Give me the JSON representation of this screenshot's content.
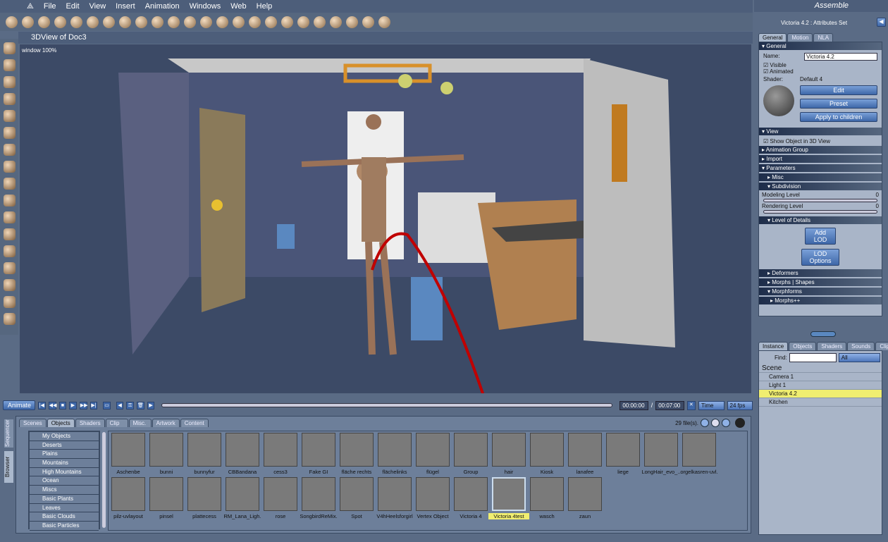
{
  "menu": [
    "File",
    "Edit",
    "View",
    "Insert",
    "Animation",
    "Windows",
    "Web",
    "Help"
  ],
  "room": "Assemble",
  "view": {
    "title": "3DView of Doc3",
    "zoom_label": "window 100%"
  },
  "timeline": {
    "animate": "Animate",
    "current": "00:00:00",
    "end": "00:07:00",
    "separator": "/",
    "mode": "Time",
    "fps": "24 fps"
  },
  "browser": {
    "side_tabs": [
      "Sequencer",
      "Browser"
    ],
    "tabs": [
      "Scenes",
      "Objects",
      "Shaders",
      "Clip",
      "Misc.",
      "Artwork",
      "Content"
    ],
    "active_tab": "Objects",
    "file_count": "29 file(s).",
    "categories": [
      "My Objects",
      "Deserts",
      "Plains",
      "Mountains",
      "High Mountains",
      "Ocean",
      "Miscs",
      "Basic Plants",
      "Leaves",
      "Basic Clouds",
      "Basic Particles"
    ],
    "items": [
      "Aschenbe",
      "bunni",
      "bunnyfur",
      "CBBandana",
      "cess3",
      "Fake GI",
      "fläche rechts",
      "flächelinks",
      "flügel",
      "Group",
      "hair",
      "Kiosk",
      "lanafee",
      "liege",
      "LongHair_evo_..",
      "orgelkasren-uvl.",
      "pilz-uvlayout",
      "pinsel",
      "plattecess",
      "RM_Lana_Ligh.",
      "rose",
      "SongbirdReMix.",
      "Spot",
      "V4hHeelsforgirl",
      "Vertex Object",
      "Victoria 4",
      "Victoria 4test",
      "wasch",
      "zaun"
    ],
    "selected_item": "Victoria 4test"
  },
  "attributes": {
    "title": "Victoria 4.2 : Attributes Set",
    "tabs": [
      "General",
      "Motion",
      "NLA"
    ],
    "general": "General",
    "name_label": "Name:",
    "name_value": "Victoria 4.2",
    "visible": "Visible",
    "animated": "Animated",
    "shader_label": "Shader:",
    "shader_value": "Default 4",
    "edit": "Edit",
    "preset": "Preset",
    "apply": "Apply to children",
    "view": "View",
    "show_obj": "Show Object in 3D View",
    "anim_group": "Animation Group",
    "import": "Import",
    "parameters": "Parameters",
    "misc": "Misc",
    "subdivision": "Subdivision",
    "modeling": "Modeling Level",
    "modeling_val": "0",
    "rendering": "Rendering Level",
    "rendering_val": "0",
    "lod": "Level of Details",
    "add_lod": "Add LOD",
    "lod_options": "LOD Options",
    "deformers": "Deformers",
    "morphs": "Morphs | Shapes",
    "morphforms": "Morphforms",
    "morphspp": "Morphs++"
  },
  "instances": {
    "tabs": [
      "Instance",
      "Objects",
      "Shaders",
      "Sounds",
      "Clips"
    ],
    "find_label": "Find:",
    "find_value": "",
    "filter": "All",
    "scene": "Scene",
    "items": [
      "Camera 1",
      "Light 1",
      "Victoria 4.2",
      "Kitchen"
    ],
    "selected": "Victoria 4.2"
  },
  "colors": {
    "selection": "#f0ee70",
    "accent": "#3e67a8",
    "annotation": "#c00000"
  }
}
